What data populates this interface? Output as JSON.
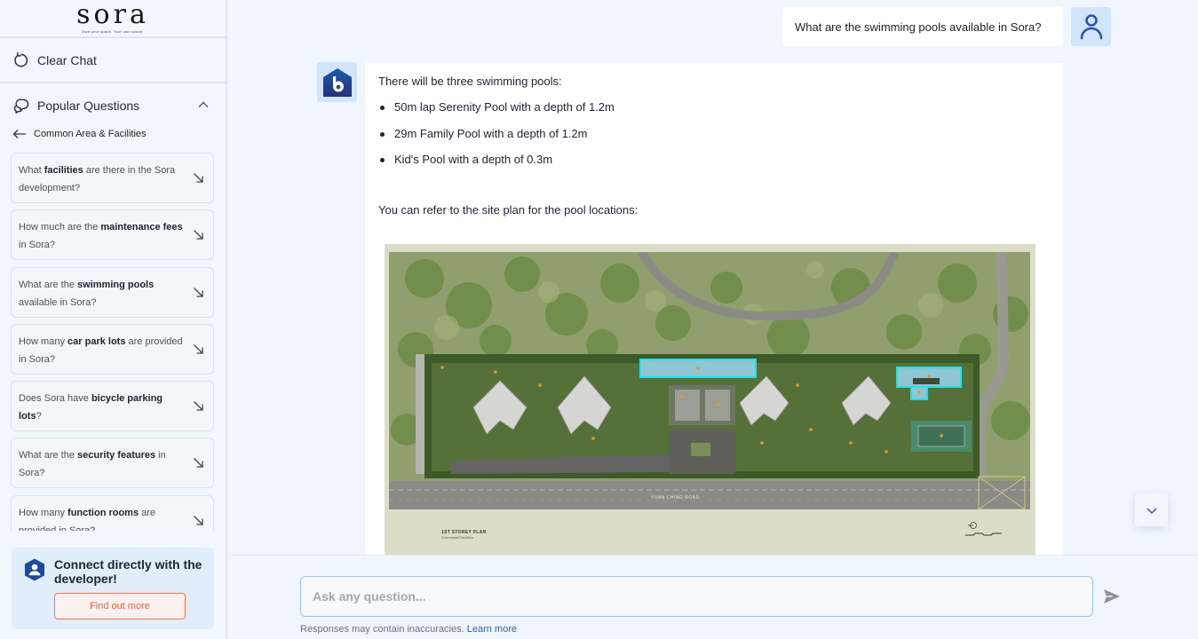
{
  "sidebar": {
    "logo": {
      "word": "sora",
      "tagline": "Own your space. Your own space."
    },
    "clear_chat": "Clear Chat",
    "popular_questions": "Popular Questions",
    "category": "Common Area & Facilities",
    "questions": [
      {
        "pre": "What ",
        "bold": "facilities",
        "post": " are there in the Sora development?"
      },
      {
        "pre": "How much are the ",
        "bold": "maintenance fees",
        "post": " in Sora?"
      },
      {
        "pre": "What are the ",
        "bold": "swimming pools",
        "post": " available in Sora?"
      },
      {
        "pre": "How many ",
        "bold": "car park lots",
        "post": " are provided in Sora?"
      },
      {
        "pre": "Does Sora have ",
        "bold": "bicycle parking lots",
        "post": "?"
      },
      {
        "pre": "What are the ",
        "bold": "security features",
        "post": " in Sora?"
      },
      {
        "pre": "How many ",
        "bold": "function rooms",
        "post": " are provided in Sora?"
      }
    ],
    "connect": {
      "title": "Connect directly with the developer!",
      "button": "Find out more"
    }
  },
  "chat": {
    "user_message": "What are the swimming pools available in Sora?",
    "bot_reply": {
      "intro": "There will be three swimming pools:",
      "items": [
        "50m lap Serenity Pool with a depth of 1.2m",
        "29m Family Pool with a depth of 1.2m",
        "Kid's Pool with a depth of 0.3m"
      ],
      "refer": "You can refer to the site plan for the pool locations:",
      "image": {
        "title": "1ST STOREY PLAN",
        "subtitle": "Communal Facilities",
        "road_label": "YUAN CHING ROAD"
      }
    }
  },
  "composer": {
    "placeholder": "Ask any question...",
    "value": "",
    "disclaimer": "Responses may contain inaccuracies.",
    "learn_more": "Learn more"
  },
  "colors": {
    "accent_blue": "#2d5fa8",
    "brand_navy": "#1f3f8a",
    "cta_orange": "#e8653c",
    "pool_highlight": "#22e0e8"
  }
}
